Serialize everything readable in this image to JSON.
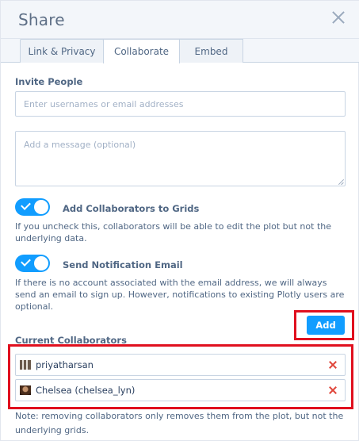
{
  "modal": {
    "title": "Share",
    "close_icon": "close-icon"
  },
  "tabs": [
    {
      "label": "Link & Privacy",
      "active": false
    },
    {
      "label": "Collaborate",
      "active": true
    },
    {
      "label": "Embed",
      "active": false
    }
  ],
  "invite": {
    "label": "Invite People",
    "usernames_placeholder": "Enter usernames or email addresses",
    "usernames_value": "",
    "message_placeholder": "Add a message (optional)",
    "message_value": ""
  },
  "toggles": {
    "grids": {
      "label": "Add Collaborators to Grids",
      "on": true,
      "help": "If you uncheck this, collaborators will be able to edit the plot but not the underlying data."
    },
    "notify": {
      "label": "Send Notification Email",
      "on": true,
      "help": "If there is no account associated with the email address, we will always send an email to sign up. However, notifications to existing Plotly users are optional."
    }
  },
  "add_button": {
    "label": "Add"
  },
  "collaborators": {
    "label": "Current Collaborators",
    "items": [
      {
        "name": "priyatharsan",
        "avatar": "pixel-avatar-icon",
        "remove_icon": "remove-x-icon"
      },
      {
        "name": "Chelsea (chelsea_lyn)",
        "avatar": "photo-avatar-icon",
        "remove_icon": "remove-x-icon"
      }
    ],
    "note": "Note: removing collaborators only removes them from the plot, but not the underlying grids."
  },
  "colors": {
    "accent": "#119dff",
    "highlight_box": "#e0101f",
    "remove_x": "#e0473c",
    "header_bg": "#f3f6fa"
  }
}
